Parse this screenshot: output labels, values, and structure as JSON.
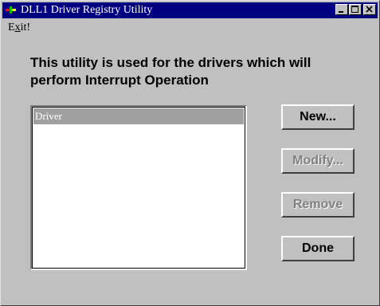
{
  "window": {
    "title": "DLL1 Driver Registry Utility",
    "title_bar_color": "#000080",
    "background_color": "#c0c0c0",
    "icons": {
      "app": "app-icon",
      "minimize": "minimize-icon",
      "maximize": "maximize-icon",
      "close": "close-icon"
    }
  },
  "menu": {
    "exit_prefix": "E",
    "exit_accel": "x",
    "exit_suffix": "it!"
  },
  "description": "This utility is used for the drivers which will perform Interrupt Operation",
  "list": {
    "header": "Driver",
    "items": []
  },
  "buttons": {
    "new": "New...",
    "modify": "Modify...",
    "remove": "Remove",
    "done": "Done"
  }
}
